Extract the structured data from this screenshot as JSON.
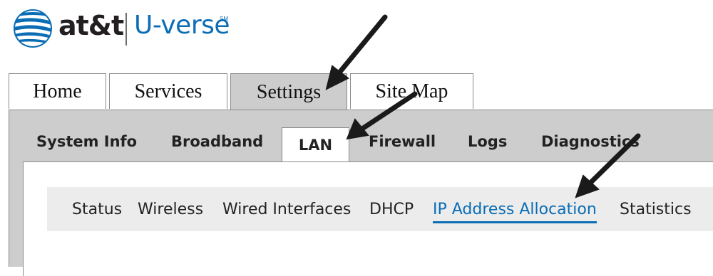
{
  "logo": {
    "brand": "at&t",
    "product": "U-verse",
    "mark": "SM"
  },
  "main_tabs": [
    {
      "label": "Home"
    },
    {
      "label": "Services"
    },
    {
      "label": "Settings"
    },
    {
      "label": "Site Map"
    }
  ],
  "active_main_tab": "Settings",
  "sub_tabs": [
    {
      "label": "System Info"
    },
    {
      "label": "Broadband"
    },
    {
      "label": "LAN"
    },
    {
      "label": "Firewall"
    },
    {
      "label": "Logs"
    },
    {
      "label": "Diagnostics"
    }
  ],
  "active_sub_tab": "LAN",
  "lan_nav": [
    {
      "label": "Status"
    },
    {
      "label": "Wireless"
    },
    {
      "label": "Wired Interfaces"
    },
    {
      "label": "DHCP"
    },
    {
      "label": "IP Address Allocation"
    },
    {
      "label": "Statistics"
    }
  ],
  "active_lan_item": "IP Address Allocation",
  "colors": {
    "accent": "#0a6db5",
    "panel": "#cdcdcd",
    "subnav_bg": "#ececec"
  }
}
